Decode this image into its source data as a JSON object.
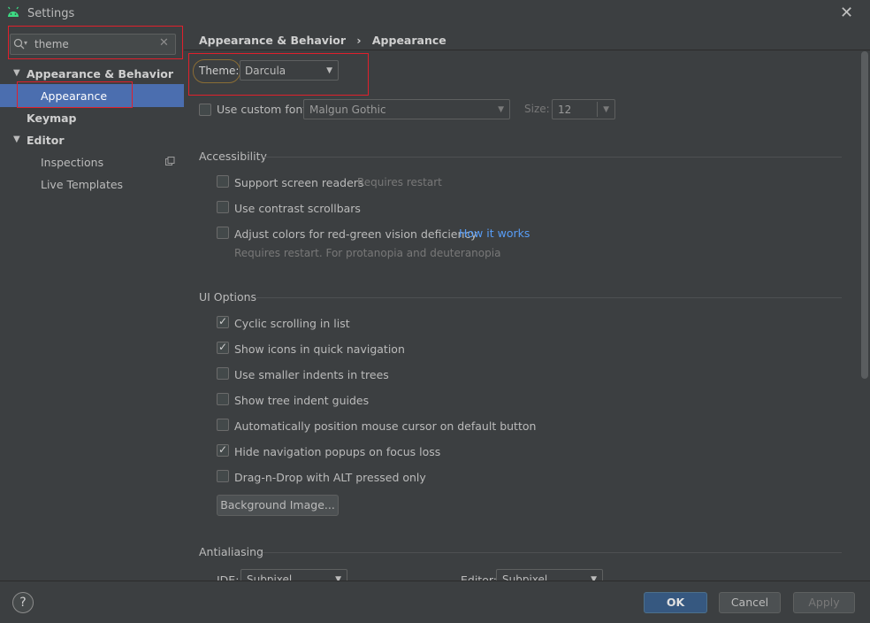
{
  "window": {
    "title": "Settings"
  },
  "sidebar": {
    "search_value": "theme",
    "tree": [
      {
        "label": "Appearance & Behavior",
        "expanded": true
      },
      {
        "label": "Appearance",
        "selected": true
      },
      {
        "label": "Keymap"
      },
      {
        "label": "Editor",
        "expanded": true
      },
      {
        "label": "Inspections"
      },
      {
        "label": "Live Templates"
      }
    ]
  },
  "breadcrumb": {
    "parent": "Appearance & Behavior",
    "separator": "›",
    "current": "Appearance"
  },
  "theme": {
    "label": "Theme:",
    "value": "Darcula"
  },
  "font": {
    "custom_label": "Use custom font:",
    "font_value": "Malgun Gothic",
    "size_label": "Size:",
    "size_value": "12"
  },
  "accessibility": {
    "title": "Accessibility",
    "screen_readers": "Support screen readers",
    "screen_readers_hint": "Requires restart",
    "contrast_scrollbars": "Use contrast scrollbars",
    "adjust_colors": "Adjust colors for red-green vision deficiency",
    "how_it_works": "How it works",
    "adjust_hint": "Requires restart. For protanopia and deuteranopia"
  },
  "ui_options": {
    "title": "UI Options",
    "items": [
      {
        "label": "Cyclic scrolling in list",
        "checked": true
      },
      {
        "label": "Show icons in quick navigation",
        "checked": true
      },
      {
        "label": "Use smaller indents in trees",
        "checked": false
      },
      {
        "label": "Show tree indent guides",
        "checked": false
      },
      {
        "label": "Automatically position mouse cursor on default button",
        "checked": false
      },
      {
        "label": "Hide navigation popups on focus loss",
        "checked": true
      },
      {
        "label": "Drag-n-Drop with ALT pressed only",
        "checked": false
      }
    ],
    "background_image": "Background Image..."
  },
  "antialiasing": {
    "title": "Antialiasing",
    "ide_label": "IDE:",
    "ide_value": "Subpixel",
    "editor_label": "Editor:",
    "editor_value": "Subpixel"
  },
  "footer": {
    "help": "?",
    "ok": "OK",
    "cancel": "Cancel",
    "apply": "Apply"
  },
  "colors": {
    "accent": "#4b6eaf",
    "ok_button": "#365880",
    "highlight_box": "#e0202c",
    "link": "#589df6"
  }
}
